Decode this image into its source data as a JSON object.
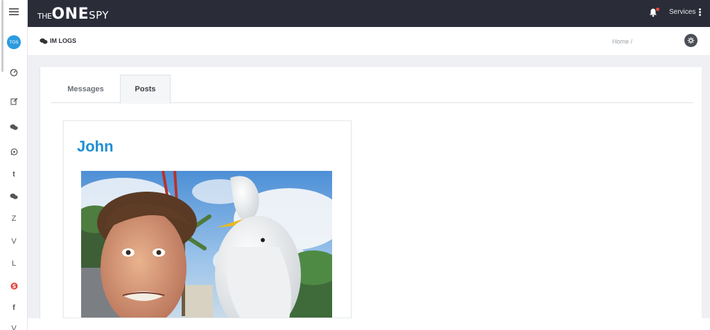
{
  "topbar": {
    "logo_the": "THE",
    "logo_one": "ONE",
    "logo_spy": "SPY",
    "services_label": "Services"
  },
  "sidebar": {
    "avatar_initials": "TOS",
    "letter_items": [
      "t",
      "Z",
      "V",
      "L",
      "f",
      "V"
    ]
  },
  "header": {
    "title": "IM LOGS",
    "breadcrumb": "Home /"
  },
  "tabs": {
    "messages": "Messages",
    "posts": "Posts",
    "active": "Posts"
  },
  "post": {
    "author": "John"
  },
  "colors": {
    "topbar_bg": "#2a2c38",
    "accent_blue": "#1f8fd3",
    "notification_dot": "#e14b3b"
  }
}
